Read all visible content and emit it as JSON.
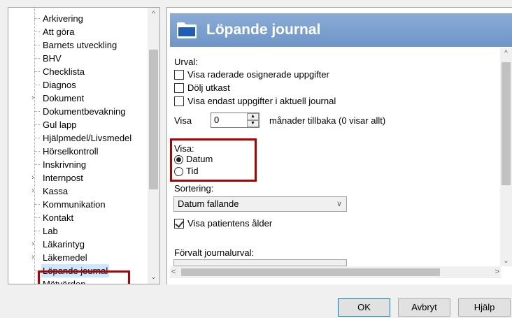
{
  "tree": {
    "items": [
      {
        "label": "Arkivering",
        "expandable": false
      },
      {
        "label": "Att göra",
        "expandable": false
      },
      {
        "label": "Barnets utveckling",
        "expandable": false
      },
      {
        "label": "BHV",
        "expandable": false
      },
      {
        "label": "Checklista",
        "expandable": false
      },
      {
        "label": "Diagnos",
        "expandable": false
      },
      {
        "label": "Dokument",
        "expandable": true
      },
      {
        "label": "Dokumentbevakning",
        "expandable": false
      },
      {
        "label": "Gul lapp",
        "expandable": false
      },
      {
        "label": "Hjälpmedel/Livsmedel",
        "expandable": false
      },
      {
        "label": "Hörselkontroll",
        "expandable": false
      },
      {
        "label": "Inskrivning",
        "expandable": false
      },
      {
        "label": "Internpost",
        "expandable": true
      },
      {
        "label": "Kassa",
        "expandable": true
      },
      {
        "label": "Kommunikation",
        "expandable": false
      },
      {
        "label": "Kontakt",
        "expandable": false
      },
      {
        "label": "Lab",
        "expandable": false
      },
      {
        "label": "Läkarintyg",
        "expandable": true
      },
      {
        "label": "Läkemedel",
        "expandable": true
      },
      {
        "label": "Löpande journal",
        "expandable": false,
        "selected": true
      },
      {
        "label": "Mätvärden",
        "expandable": false
      }
    ],
    "expander_glyph": "›",
    "scroll_up_glyph": "^",
    "scroll_down_glyph": "⌄"
  },
  "panel": {
    "title": "Löpande journal",
    "icon": "folder-icon",
    "urval_label": "Urval:",
    "checkboxes": [
      {
        "label": "Visa raderade osignerade uppgifter",
        "checked": false
      },
      {
        "label": "Dölj utkast",
        "checked": false
      },
      {
        "label": "Visa endast uppgifter i aktuell journal",
        "checked": false
      }
    ],
    "months_prefix": "Visa",
    "months_value": "0",
    "months_suffix": "månader tillbaka (0 visar allt)",
    "visa_label": "Visa:",
    "radios": [
      {
        "label": "Datum",
        "checked": true
      },
      {
        "label": "Tid",
        "checked": false
      }
    ],
    "sort_label": "Sortering:",
    "sort_value": "Datum fallande",
    "show_age_label": "Visa patientens ålder",
    "show_age_checked": true,
    "default_selection_label": "Förvalt journalurval:"
  },
  "buttons": {
    "ok": "OK",
    "cancel": "Avbryt",
    "help": "Hjälp"
  },
  "colors": {
    "header_bg": "#7fa3d0",
    "highlight": "#b00000",
    "selection": "#cce8ff"
  }
}
